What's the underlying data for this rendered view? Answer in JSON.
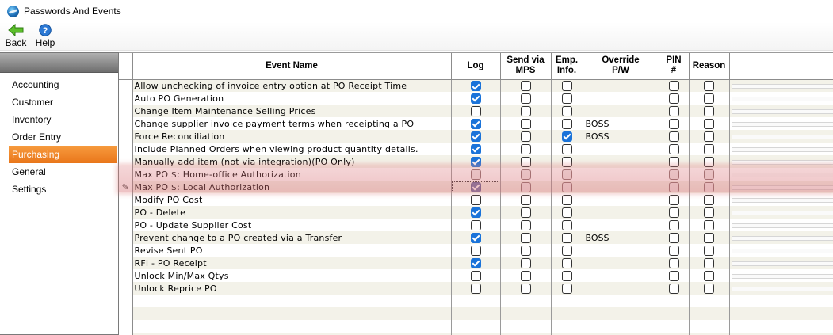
{
  "window": {
    "title": "Passwords And Events"
  },
  "toolbar": {
    "back_label": "Back",
    "help_label": "Help"
  },
  "sidebar": {
    "items": [
      {
        "label": "Accounting",
        "active": false
      },
      {
        "label": "Customer",
        "active": false
      },
      {
        "label": "Inventory",
        "active": false
      },
      {
        "label": "Order Entry",
        "active": false
      },
      {
        "label": "Purchasing",
        "active": true
      },
      {
        "label": "General",
        "active": false
      },
      {
        "label": "Settings",
        "active": false
      }
    ]
  },
  "grid": {
    "columns": {
      "event_name": "Event Name",
      "log": "Log",
      "send_mps": "Send via\nMPS",
      "emp_info": "Emp.\nInfo.",
      "override": "Override\nP/W",
      "pin": "PIN\n#",
      "reason": "Reason"
    },
    "rows": [
      {
        "name": "Allow unchecking of invoice entry option at PO Receipt Time",
        "log": true,
        "mps": false,
        "emp": false,
        "override": "",
        "pin": false,
        "reason": false
      },
      {
        "name": "Auto PO Generation",
        "log": true,
        "mps": false,
        "emp": false,
        "override": "",
        "pin": false,
        "reason": false
      },
      {
        "name": "Change Item Maintenance Selling Prices",
        "log": false,
        "mps": false,
        "emp": false,
        "override": "",
        "pin": false,
        "reason": false
      },
      {
        "name": "Change supplier invoice payment terms when receipting a PO",
        "log": true,
        "mps": false,
        "emp": false,
        "override": "BOSS",
        "pin": false,
        "reason": false
      },
      {
        "name": "Force Reconciliation",
        "log": true,
        "mps": false,
        "emp": true,
        "override": "BOSS",
        "pin": false,
        "reason": false
      },
      {
        "name": "Include Planned Orders when viewing product quantity details.",
        "log": true,
        "mps": false,
        "emp": false,
        "override": "",
        "pin": false,
        "reason": false
      },
      {
        "name": "Manually add item (not via integration)(PO Only)",
        "log": true,
        "mps": false,
        "emp": false,
        "override": "",
        "pin": false,
        "reason": false
      },
      {
        "name": "Max PO $: Home-office Authorization",
        "log": false,
        "mps": false,
        "emp": false,
        "override": "",
        "pin": false,
        "reason": false
      },
      {
        "name": "Max PO $: Local Authorization",
        "log": true,
        "mps": false,
        "emp": false,
        "override": "",
        "pin": false,
        "reason": false
      },
      {
        "name": "Modify PO Cost",
        "log": false,
        "mps": false,
        "emp": false,
        "override": "",
        "pin": false,
        "reason": false
      },
      {
        "name": "PO - Delete",
        "log": true,
        "mps": false,
        "emp": false,
        "override": "",
        "pin": false,
        "reason": false
      },
      {
        "name": "PO - Update Supplier Cost",
        "log": false,
        "mps": false,
        "emp": false,
        "override": "",
        "pin": false,
        "reason": false
      },
      {
        "name": "Prevent change to a PO created via a Transfer",
        "log": true,
        "mps": false,
        "emp": false,
        "override": "BOSS",
        "pin": false,
        "reason": false
      },
      {
        "name": "Revise Sent PO",
        "log": false,
        "mps": false,
        "emp": false,
        "override": "",
        "pin": false,
        "reason": false
      },
      {
        "name": "RFI - PO Receipt",
        "log": true,
        "mps": false,
        "emp": false,
        "override": "",
        "pin": false,
        "reason": false
      },
      {
        "name": "Unlock Min/Max Qtys",
        "log": false,
        "mps": false,
        "emp": false,
        "override": "",
        "pin": false,
        "reason": false
      },
      {
        "name": "Unlock Reprice PO",
        "log": false,
        "mps": false,
        "emp": false,
        "override": "",
        "pin": false,
        "reason": false
      }
    ],
    "highlighted_rows": [
      7,
      8
    ],
    "editing_row": 8
  },
  "colors": {
    "accent": "#e9761a",
    "checkbox_on": "#1a73d9",
    "row_alt": "#f3f2e9",
    "highlight": "#dc787d"
  },
  "icons": {
    "back": "back-arrow-icon",
    "help": "help-question-icon",
    "app": "app-globe-icon",
    "edit": "pencil-icon"
  }
}
